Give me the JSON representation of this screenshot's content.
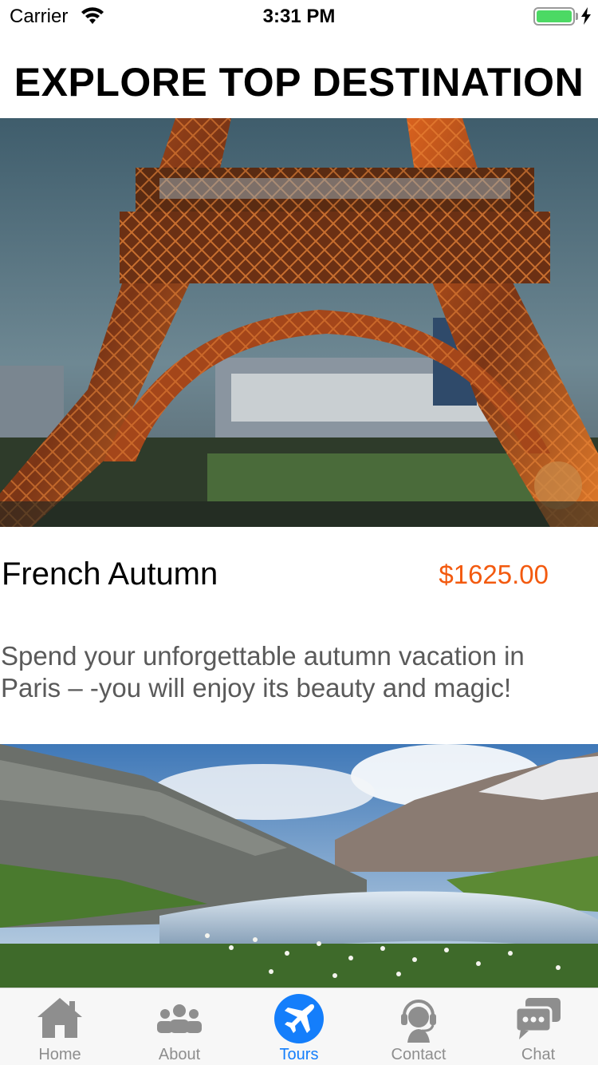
{
  "status_bar": {
    "carrier": "Carrier",
    "time": "3:31 PM",
    "battery_color": "#4cd964"
  },
  "header": {
    "title": "EXPLORE TOP DESTINATION"
  },
  "tours": [
    {
      "image_icon": "eiffel-tower-photo",
      "title": "French Autumn",
      "price": "$1625.00",
      "description": "Spend your unforgettable autumn vacation in Paris – -you will enjoy its beauty and magic!"
    },
    {
      "image_icon": "mountain-river-photo"
    }
  ],
  "tab_bar": {
    "active_color": "#147efb",
    "inactive_color": "#8e8e8e",
    "items": [
      {
        "label": "Home",
        "icon": "home-icon"
      },
      {
        "label": "About",
        "icon": "people-icon"
      },
      {
        "label": "Tours",
        "icon": "airplane-icon",
        "active": true
      },
      {
        "label": "Contact",
        "icon": "headset-icon"
      },
      {
        "label": "Chat",
        "icon": "chat-bubbles-icon"
      }
    ]
  },
  "accent_colors": {
    "price": "#f35a0f"
  }
}
